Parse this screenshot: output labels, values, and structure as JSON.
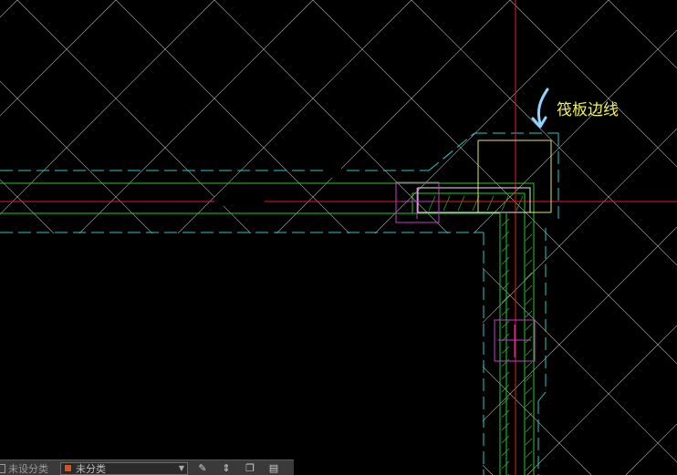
{
  "app": {
    "annotation_label": "筏板边线",
    "annotation_color": "#f2f24a",
    "arrow_color": "#8fd6ff"
  },
  "statusbar": {
    "left_label": "未设分类",
    "layer_name": "未分类",
    "layer_color": "#d0561b",
    "tool_icons": [
      "pencil-icon",
      "move-icon",
      "copy-icon",
      "layer-manager-icon"
    ]
  },
  "colors": {
    "grid": "#d9d9d9",
    "cyan": "#28c8c8",
    "green": "#22cc22",
    "red": "#e31c2a",
    "yellow": "#e6e65a",
    "magenta": "#c63ccd"
  }
}
